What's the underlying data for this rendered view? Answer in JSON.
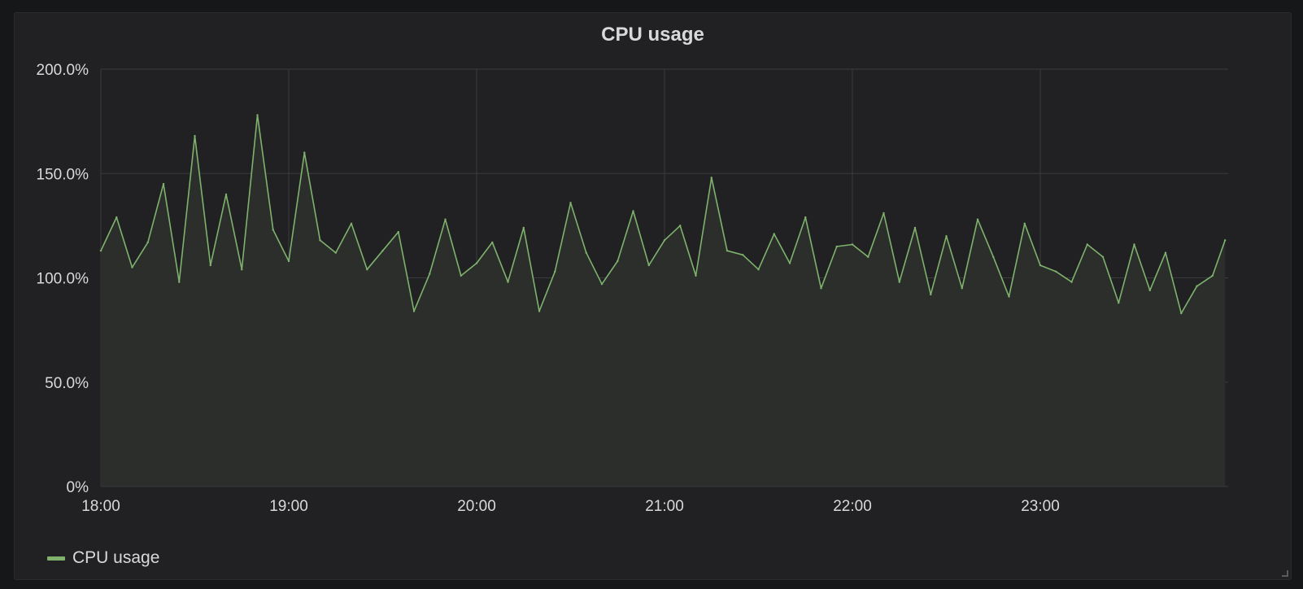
{
  "panel": {
    "title": "CPU usage",
    "legend": [
      {
        "label": "CPU usage",
        "color": "#7eb26d"
      }
    ]
  },
  "colors": {
    "series": "#7eb26d",
    "fill": "#2b2e2a",
    "grid": "#3a3b3e",
    "text": "#d8d9da",
    "background": "#212124"
  },
  "chart_data": {
    "type": "area",
    "title": "CPU usage",
    "xlabel": "",
    "ylabel": "",
    "x_range": [
      "18:00",
      "24:00"
    ],
    "ylim": [
      0,
      200
    ],
    "y_ticks": [
      "0%",
      "50.0%",
      "100.0%",
      "150.0%",
      "200.0%"
    ],
    "x_ticks": [
      "18:00",
      "19:00",
      "20:00",
      "21:00",
      "22:00",
      "23:00"
    ],
    "grid": true,
    "legend_position": "bottom-left",
    "series": [
      {
        "name": "CPU usage",
        "color": "#7eb26d",
        "fill": true,
        "x": [
          "18:00",
          "18:05",
          "18:10",
          "18:15",
          "18:20",
          "18:25",
          "18:30",
          "18:35",
          "18:40",
          "18:45",
          "18:50",
          "18:55",
          "19:00",
          "19:05",
          "19:10",
          "19:15",
          "19:20",
          "19:25",
          "19:30",
          "19:35",
          "19:40",
          "19:45",
          "19:50",
          "19:55",
          "20:00",
          "20:05",
          "20:10",
          "20:15",
          "20:20",
          "20:25",
          "20:30",
          "20:35",
          "20:40",
          "20:45",
          "20:50",
          "20:55",
          "21:00",
          "21:05",
          "21:10",
          "21:15",
          "21:20",
          "21:25",
          "21:30",
          "21:35",
          "21:40",
          "21:45",
          "21:50",
          "21:55",
          "22:00",
          "22:05",
          "22:10",
          "22:15",
          "22:20",
          "22:25",
          "22:30",
          "22:35",
          "22:40",
          "22:45",
          "22:50",
          "22:55",
          "23:00",
          "23:05",
          "23:10",
          "23:15",
          "23:20",
          "23:25",
          "23:30",
          "23:35",
          "23:40",
          "23:45",
          "23:50",
          "23:55",
          "23:59"
        ],
        "values": [
          113,
          129,
          105,
          117,
          145,
          98,
          168,
          106,
          140,
          104,
          178,
          123,
          108,
          160,
          118,
          112,
          126,
          104,
          113,
          122,
          84,
          102,
          128,
          101,
          107,
          117,
          98,
          124,
          84,
          103,
          136,
          112,
          97,
          108,
          132,
          106,
          118,
          125,
          101,
          148,
          113,
          111,
          104,
          121,
          107,
          129,
          95,
          115,
          116,
          110,
          131,
          98,
          124,
          92,
          120,
          95,
          128,
          110,
          91,
          126,
          106,
          103,
          98,
          116,
          110,
          88,
          116,
          94,
          112,
          83,
          96,
          101,
          118
        ]
      }
    ]
  }
}
